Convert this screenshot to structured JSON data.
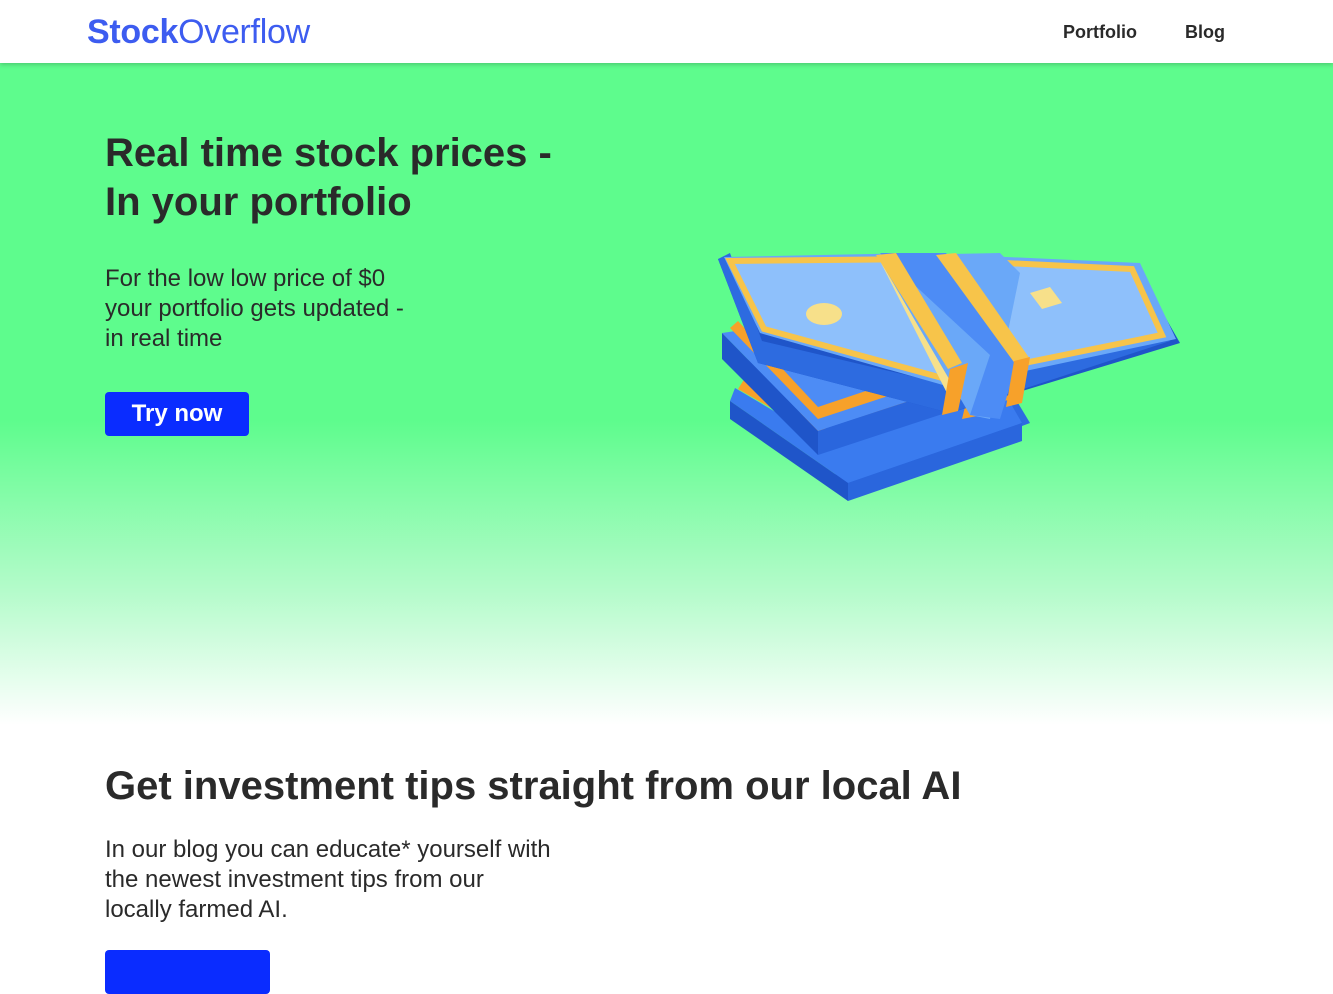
{
  "navbar": {
    "logo_bold": "Stock",
    "logo_light": "Overflow",
    "links": [
      {
        "label": "Portfolio"
      },
      {
        "label": "Blog"
      }
    ]
  },
  "hero": {
    "title_lines": [
      "Real time stock prices -",
      "In your portfolio"
    ],
    "subtitle_lines": [
      "For the low low price of $0",
      "your portfolio gets updated -",
      "in real time"
    ],
    "cta_label": "Try now",
    "illustration": "money-stack-icon"
  },
  "tips": {
    "title": "Get investment tips straight from our local AI",
    "subtitle_lines": [
      "In our blog you can educate* yourself with",
      "the newest investment tips from our",
      "locally farmed AI."
    ]
  },
  "colors": {
    "brand": "#3d5cf0",
    "hero_green": "#5efc8d",
    "button_blue": "#0a2cff",
    "bill_blue": "#4d8cf5",
    "band_orange": "#f7a12a"
  }
}
